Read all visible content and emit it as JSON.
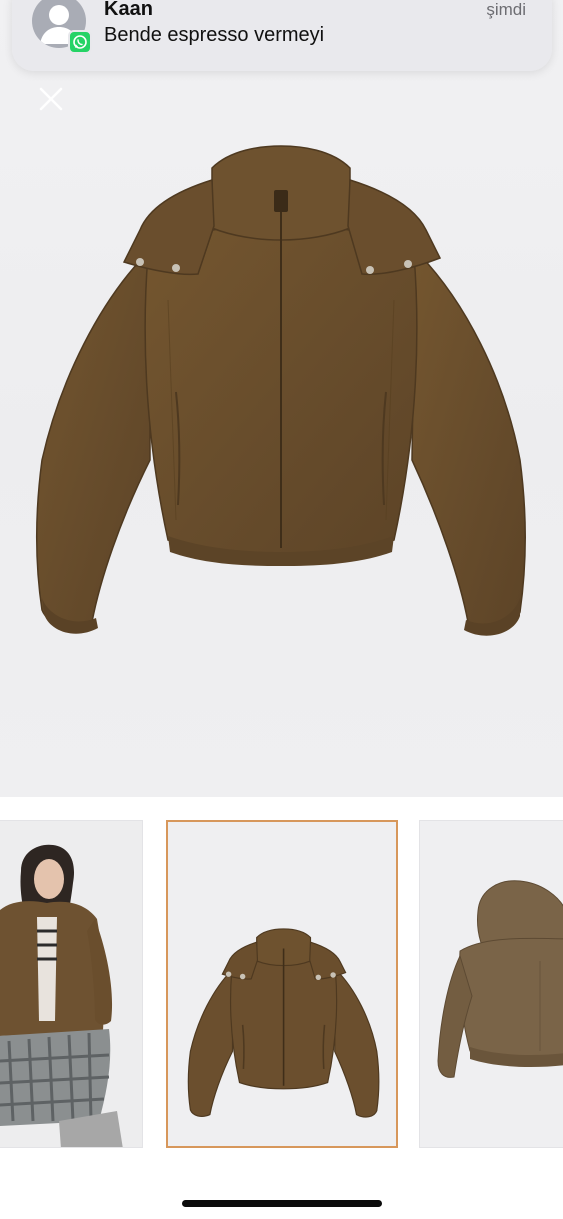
{
  "notification": {
    "sender": "Kaan",
    "message": "Bende espresso vermeyi",
    "time": "şimdi",
    "app_icon": "whatsapp-icon",
    "avatar_icon": "person-silhouette-icon"
  },
  "viewer": {
    "close_icon": "close-icon",
    "main_image": "brown-hooded-puffer-jacket",
    "jacket_color": "#6b4f2e"
  },
  "gallery": {
    "selected_index": 1,
    "selected_border_color": "#d7975b",
    "thumbnails": [
      {
        "name": "model-wearing-jacket"
      },
      {
        "name": "jacket-front"
      },
      {
        "name": "jacket-back"
      }
    ]
  }
}
